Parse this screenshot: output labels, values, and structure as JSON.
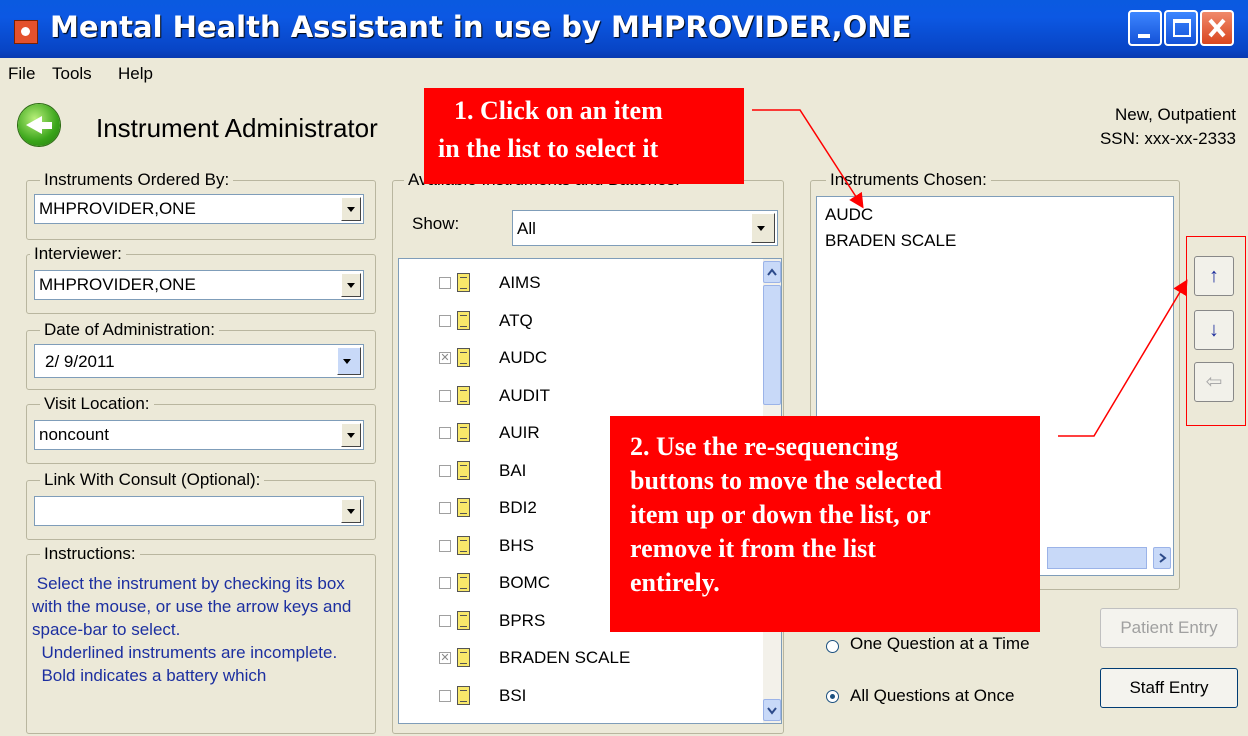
{
  "window": {
    "title": "Mental Health Assistant in use by MHPROVIDER,ONE",
    "colors": {
      "titlebar": "#0a5ae0",
      "callout": "#ff0000",
      "arrow": "#ff0000"
    }
  },
  "menu": [
    "File",
    "Tools",
    "Help"
  ],
  "header": {
    "title": "Instrument Administrator",
    "patient_status": "New, Outpatient",
    "ssn": "SSN: xxx-xx-2333"
  },
  "ordered_by": {
    "label": "Instruments Ordered By:",
    "value": "MHPROVIDER,ONE"
  },
  "interviewer": {
    "label": "Interviewer:",
    "value": "MHPROVIDER,ONE"
  },
  "date_admin": {
    "label": "Date of Administration:",
    "value": "2/ 9/2011"
  },
  "visit_location": {
    "label": "Visit Location:",
    "value": "noncount"
  },
  "consult": {
    "label": "Link With Consult (Optional):",
    "value": ""
  },
  "instructions": {
    "label": "Instructions:",
    "text": " Select the instrument by checking its box with the mouse, or use the arrow keys and space-bar to select.\n  Underlined instruments are incomplete.\n  Bold indicates a battery which"
  },
  "available": {
    "label": "Available Instruments and Batteries:",
    "show_label": "Show:",
    "show_value": "All",
    "items": [
      {
        "name": "AIMS",
        "checked": false
      },
      {
        "name": "ATQ",
        "checked": false
      },
      {
        "name": "AUDC",
        "checked": true
      },
      {
        "name": "AUDIT",
        "checked": false
      },
      {
        "name": "AUIR",
        "checked": false
      },
      {
        "name": "BAI",
        "checked": false
      },
      {
        "name": "BDI2",
        "checked": false
      },
      {
        "name": "BHS",
        "checked": false
      },
      {
        "name": "BOMC",
        "checked": false
      },
      {
        "name": "BPRS",
        "checked": false
      },
      {
        "name": "BRADEN SCALE",
        "checked": true
      },
      {
        "name": "BSI",
        "checked": false
      }
    ]
  },
  "chosen": {
    "label": "Instruments Chosen:",
    "items": [
      "AUDC",
      "BRADEN SCALE"
    ]
  },
  "sequence_buttons": {
    "up": "↑",
    "down": "↓",
    "remove": "⇦"
  },
  "mode": {
    "one_question": "One Question at a Time",
    "all_questions": "All Questions at Once",
    "selected": "all_questions"
  },
  "buttons": {
    "patient_entry": "Patient Entry",
    "staff_entry": "Staff Entry"
  },
  "callouts": {
    "c1_line1": "1. Click on an item",
    "c1_line2": "in the list to select it",
    "c2_lines": [
      "2. Use the re-sequencing",
      "buttons to move the selected",
      "item up or down the list, or",
      "remove it from the list",
      "entirely."
    ]
  }
}
